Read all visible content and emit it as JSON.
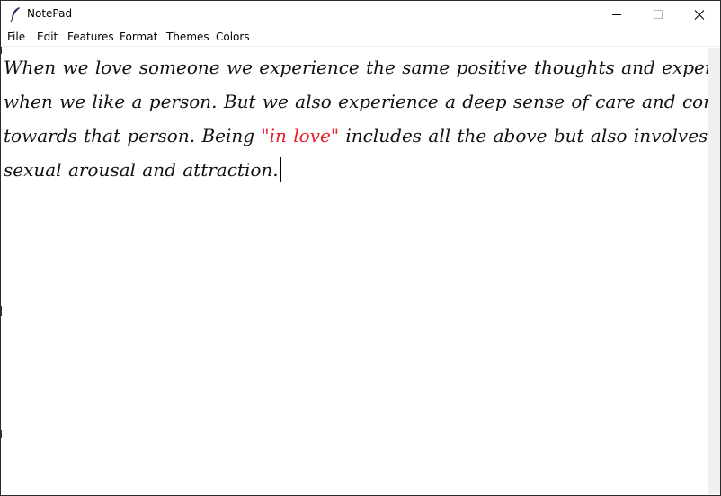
{
  "window": {
    "title": "NotePad",
    "icon": "feather-pen-icon",
    "controls": {
      "minimize_icon": "minimize-icon",
      "maximize_icon": "maximize-icon",
      "close_icon": "close-icon"
    }
  },
  "menubar": {
    "items": [
      {
        "label": "File"
      },
      {
        "label": "Edit"
      },
      {
        "label": "Features"
      },
      {
        "label": "Format"
      },
      {
        "label": "Themes"
      },
      {
        "label": "Colors"
      }
    ]
  },
  "editor": {
    "lines": [
      {
        "text": "When we love someone we experience the same positive thoughts and experiences as"
      },
      {
        "text": "when we like a person. But we also experience a deep sense of care and commitment"
      },
      {
        "before": "towards that person. Being ",
        "highlight": "\"in love\"",
        "after": " includes all the above but also involves feelings of"
      },
      {
        "text": "sexual arousal and attraction."
      }
    ],
    "highlight_color": "#e8202a",
    "text_color": "#111111"
  }
}
